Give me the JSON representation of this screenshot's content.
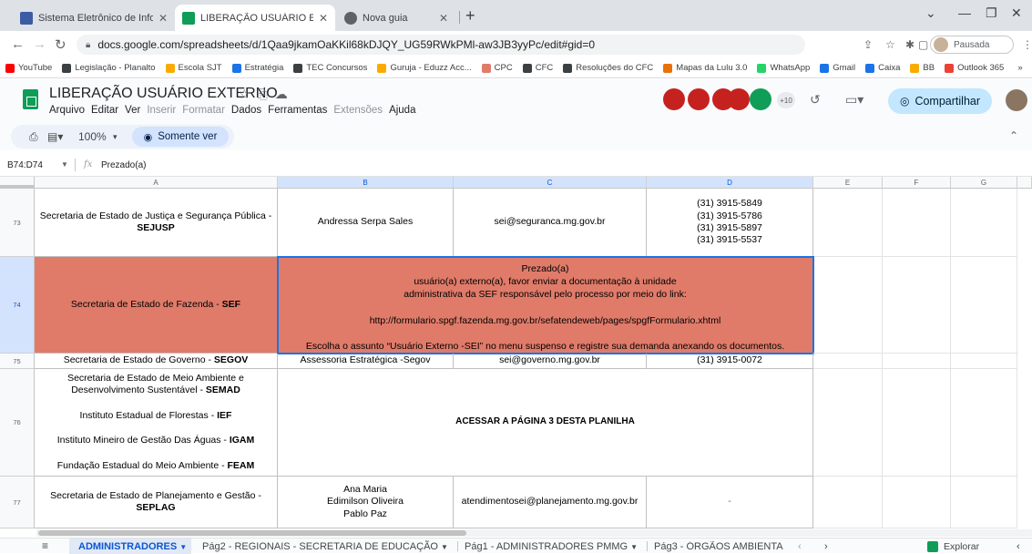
{
  "browser": {
    "tabs": [
      {
        "label": "Sistema Eletrônico de Informação",
        "favicon_color": "#3b5ba5",
        "active": false
      },
      {
        "label": "LIBERAÇÃO USUÁRIO EXTERNO",
        "favicon_color": "#0f9d58",
        "active": true
      },
      {
        "label": "Nova guia",
        "favicon_color": "#5f6368",
        "active": false
      }
    ],
    "new_tab_icon": "plus-icon",
    "window_controls": [
      "chevron-down-icon",
      "minimize-icon",
      "restore-icon",
      "close-icon"
    ],
    "url": "docs.google.com/spreadsheets/d/1Qaa9jkamOaKKil68kDJQY_UG59RWkPMl-aw3JB3yyPc/edit#gid=0",
    "profile_label": "Pausada",
    "bookmarks": [
      {
        "label": "YouTube",
        "color": "#ff0000"
      },
      {
        "label": "Legislação - Planalto",
        "color": "#3c4043"
      },
      {
        "label": "Escola SJT",
        "color": "#f9ab00"
      },
      {
        "label": "Estratégia",
        "color": "#1a73e8"
      },
      {
        "label": "TEC Concursos",
        "color": "#3c4043"
      },
      {
        "label": "Guruja - Eduzz Acc...",
        "color": "#f9ab00"
      },
      {
        "label": "CPC",
        "color": "#e07b6a"
      },
      {
        "label": "CFC",
        "color": "#3c4043"
      },
      {
        "label": "Resoluções do CFC",
        "color": "#3c4043"
      },
      {
        "label": "Mapas da Lulu 3.0",
        "color": "#e8710a"
      },
      {
        "label": "WhatsApp",
        "color": "#25d366"
      },
      {
        "label": "Gmail",
        "color": "#1a73e8"
      },
      {
        "label": "Caixa",
        "color": "#1a73e8"
      },
      {
        "label": "BB",
        "color": "#f9ab00"
      },
      {
        "label": "Outlook 365",
        "color": "#ea4335"
      }
    ]
  },
  "sheet": {
    "title": "LIBERAÇÃO USUÁRIO EXTERNO",
    "menu": [
      {
        "label": "Arquivo",
        "enabled": true
      },
      {
        "label": "Editar",
        "enabled": true
      },
      {
        "label": "Ver",
        "enabled": true
      },
      {
        "label": "Inserir",
        "enabled": false
      },
      {
        "label": "Formatar",
        "enabled": false
      },
      {
        "label": "Dados",
        "enabled": true
      },
      {
        "label": "Ferramentas",
        "enabled": true
      },
      {
        "label": "Extensões",
        "enabled": false
      },
      {
        "label": "Ajuda",
        "enabled": true
      }
    ],
    "collaborators_more": "+10",
    "share_label": "Compartilhar",
    "zoom": "100%",
    "view_only_label": "Somente ver",
    "name_box": "B74:D74",
    "formula": "Prezado(a)",
    "brand_green": "#0f9d58",
    "selection_color": "#1a73e8",
    "highlight_fill": "#e07b6a"
  },
  "grid": {
    "columns": [
      "A",
      "B",
      "C",
      "D",
      "E",
      "F",
      "G"
    ],
    "selected_columns": [
      "B",
      "C",
      "D"
    ],
    "selected_row": "74",
    "rows": [
      {
        "num": "73",
        "a_lines": [
          "Secretaria de Estado de Justiça e Segurança Pública -"
        ],
        "a_bold": "SEJUSP",
        "b": [
          "Andressa Serpa Sales"
        ],
        "c": "sei@seguranca.mg.gov.br",
        "d": [
          "(31) 3915-5849",
          "(31) 3915-5786",
          "(31) 3915-5897",
          "(31) 3915-5537"
        ]
      },
      {
        "num": "74",
        "a_text": "Secretaria de Estado de Fazenda - ",
        "a_bold": "SEF",
        "merged_lines": [
          "Prezado(a)",
          "usuário(a) externo(a), favor enviar a documentação à unidade",
          "administrativa da SEF responsável pelo processo por meio do link:",
          "",
          "http://formulario.spgf.fazenda.mg.gov.br/sefatendeweb/pages/spgfFormulario.xhtml",
          "",
          "Escolha o assunto “Usuário Externo -SEI” no menu suspenso e registre sua demanda anexando os documentos."
        ]
      },
      {
        "num": "75",
        "a_text": "Secretaria de Estado de Governo - ",
        "a_bold": "SEGOV",
        "b": [
          "Assessoria Estratégica -Segov"
        ],
        "c": "sei@governo.mg.gov.br",
        "d": [
          "(31) 3915-0072"
        ]
      },
      {
        "num": "76",
        "a_entries": [
          {
            "text": "Secretaria de Estado de Meio Ambiente e",
            "text2": "Desenvolvimento Sustentável - ",
            "bold": "SEMAD"
          },
          {
            "text": "Instituto Estadual de Florestas - ",
            "bold": "IEF"
          },
          {
            "text": "Instituto Mineiro de Gestão Das Águas - ",
            "bold": "IGAM"
          },
          {
            "text": "Fundação Estadual do Meio Ambiente - ",
            "bold": "FEAM"
          }
        ],
        "merged_bold": "ACESSAR A PÁGINA 3 DESTA PLANILHA"
      },
      {
        "num": "77",
        "a_lines": [
          "Secretaria de Estado de Planejamento e Gestão -"
        ],
        "a_bold": "SEPLAG",
        "b": [
          "Ana Maria",
          "Edimilson Oliveira",
          "Pablo Paz"
        ],
        "c": "atendimentosei@planejamento.mg.gov.br",
        "d": [
          "-"
        ]
      }
    ]
  },
  "sheet_tabs": [
    {
      "label": "ADMINISTRADORES",
      "active": true
    },
    {
      "label": "Pág2 - REGIONAIS - SECRETARIA DE EDUCAÇÃO",
      "active": false
    },
    {
      "label": "Pág1 - ADMINISTRADORES PMMG",
      "active": false
    },
    {
      "label": "Pág3 - ÓRGÃOS AMBIENTA",
      "active": false
    }
  ],
  "explore_label": "Explorar"
}
